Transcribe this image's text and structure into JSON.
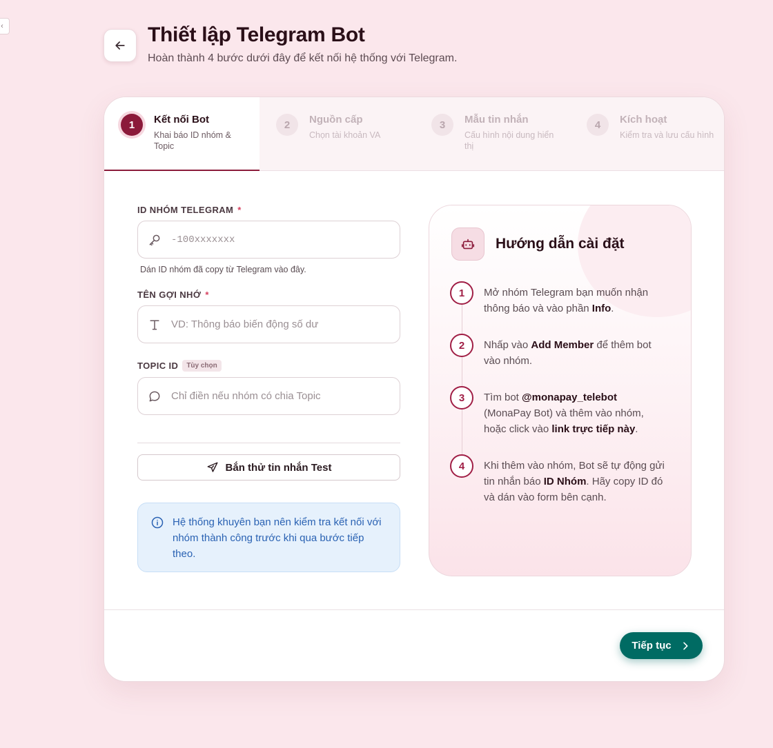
{
  "page": {
    "edge_tab_glyph": "‹",
    "title": "Thiết lập Telegram Bot",
    "subtitle": "Hoàn thành 4 bước dưới đây để kết nối hệ thống với Telegram."
  },
  "steps": [
    {
      "num": "1",
      "title": "Kết nối Bot",
      "desc": "Khai báo ID nhóm & Topic",
      "active": true
    },
    {
      "num": "2",
      "title": "Nguồn cấp",
      "desc": "Chọn tài khoản VA",
      "active": false
    },
    {
      "num": "3",
      "title": "Mẫu tin nhắn",
      "desc": "Cấu hình nội dung hiển thị",
      "active": false
    },
    {
      "num": "4",
      "title": "Kích hoạt",
      "desc": "Kiểm tra và lưu cấu hình",
      "active": false
    }
  ],
  "form": {
    "group_id": {
      "label": "ID NHÓM TELEGRAM",
      "required": "*",
      "placeholder": "-100xxxxxxx",
      "value": "",
      "hint": "Dán ID nhóm đã copy từ Telegram vào đây."
    },
    "nickname": {
      "label": "TÊN GỢI NHỚ",
      "required": "*",
      "placeholder": "VD: Thông báo biến động số dư",
      "value": ""
    },
    "topic_id": {
      "label": "TOPIC ID",
      "optional_badge": "Tùy chọn",
      "placeholder": "Chỉ điền nếu nhóm có chia Topic",
      "value": ""
    },
    "test_button": "Bắn thử tin nhắn Test",
    "notice": "Hệ thống khuyên bạn nên kiểm tra kết nối với nhóm thành công trước khi qua bước tiếp theo."
  },
  "guide": {
    "title": "Hướng dẫn cài đặt",
    "items": [
      {
        "num": "1",
        "parts": [
          {
            "t": "Mở nhóm Telegram bạn muốn nhận thông báo và vào phần "
          },
          {
            "t": "Info",
            "b": true
          },
          {
            "t": "."
          }
        ]
      },
      {
        "num": "2",
        "parts": [
          {
            "t": "Nhấp vào "
          },
          {
            "t": "Add Member",
            "b": true
          },
          {
            "t": " để thêm bot vào nhóm."
          }
        ]
      },
      {
        "num": "3",
        "parts": [
          {
            "t": "Tìm bot "
          },
          {
            "t": "@monapay_telebot",
            "b": true
          },
          {
            "t": " (MonaPay Bot) và thêm vào nhóm, hoặc click vào "
          },
          {
            "t": "link trực tiếp này",
            "b": true
          },
          {
            "t": "."
          }
        ]
      },
      {
        "num": "4",
        "parts": [
          {
            "t": "Khi thêm vào nhóm, Bot sẽ tự động gửi tin nhắn báo "
          },
          {
            "t": "ID Nhóm",
            "b": true
          },
          {
            "t": ". Hãy copy ID đó và dán vào form bên cạnh."
          }
        ]
      }
    ]
  },
  "footer": {
    "next_label": "Tiếp tục"
  },
  "colors": {
    "primary": "#8b1a3a",
    "accent": "#006b63",
    "background": "#fbe7ec",
    "info": "#2a62b3"
  },
  "icons": {
    "back": "arrow-left-icon",
    "key": "key-icon",
    "text": "text-icon",
    "chat": "chat-bubble-icon",
    "send": "send-icon",
    "info": "info-icon",
    "bot": "robot-icon",
    "next": "chevron-right-icon"
  }
}
